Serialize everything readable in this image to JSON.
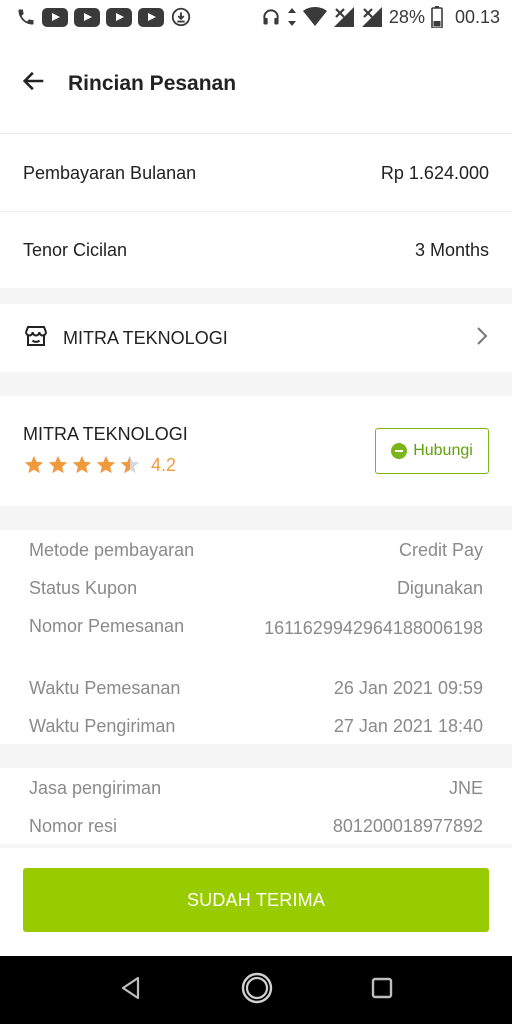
{
  "status_bar": {
    "battery_percent": "28%",
    "time": "00.13"
  },
  "header": {
    "title": "Rincian Pesanan"
  },
  "summary": {
    "monthly_label": "Pembayaran Bulanan",
    "monthly_value": "Rp 1.624.000",
    "tenor_label": "Tenor Cicilan",
    "tenor_value": "3 Months"
  },
  "store": {
    "name": "MITRA TEKNOLOGI"
  },
  "seller": {
    "name": "MITRA TEKNOLOGI",
    "rating": "4.2",
    "rating_stars": 4.5,
    "contact_label": "Hubungi"
  },
  "order_info": {
    "payment_method_label": "Metode pembayaran",
    "payment_method_value": "Credit Pay",
    "coupon_label": "Status Kupon",
    "coupon_value": "Digunakan",
    "order_no_label": "Nomor Pemesanan",
    "order_no_value": "1611629942964188006198",
    "order_time_label": "Waktu Pemesanan",
    "order_time_value": "26 Jan 2021 09:59",
    "ship_time_label": "Waktu Pengiriman",
    "ship_time_value": "27 Jan 2021 18:40"
  },
  "shipping": {
    "courier_label": "Jasa pengiriman",
    "courier_value": "JNE",
    "tracking_label": "Nomor resi",
    "tracking_value": "801200018977892"
  },
  "actions": {
    "confirm_label": "SUDAH TERIMA"
  },
  "colors": {
    "accent_green": "#99cc00",
    "rating_orange": "#f09a3e"
  }
}
